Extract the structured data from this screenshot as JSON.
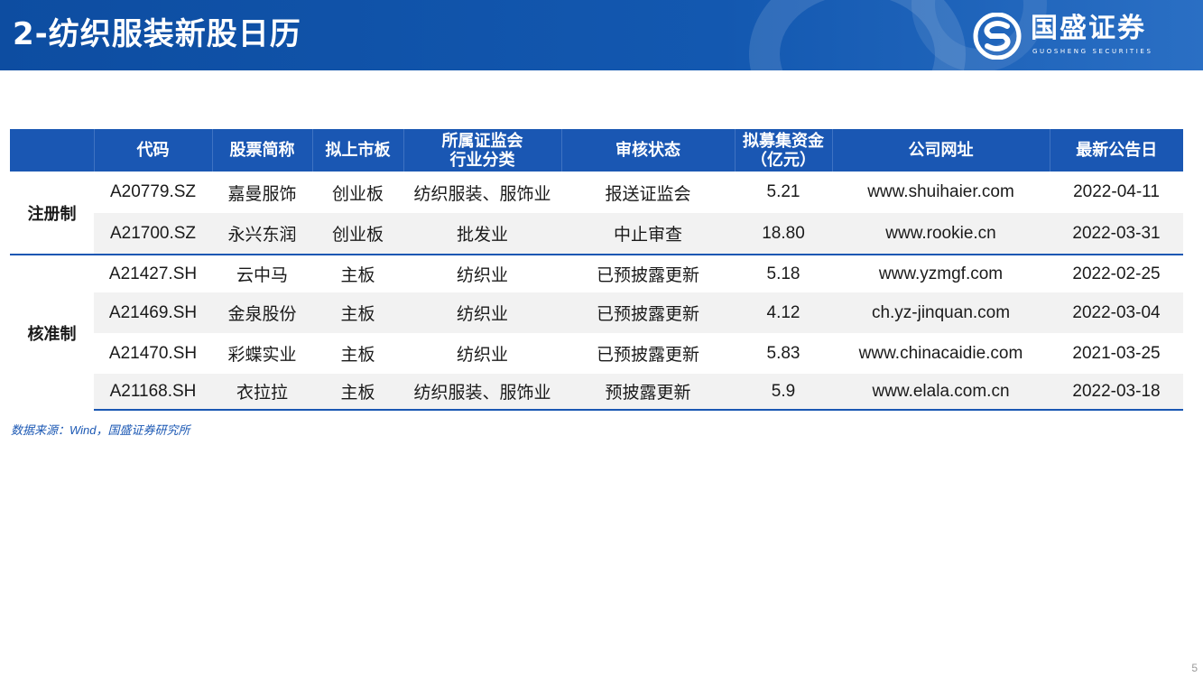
{
  "header": {
    "title": "2-纺织服装新股日历",
    "logo_name": "国盛证券",
    "logo_en": "GUOSHENG SECURITIES"
  },
  "table": {
    "columns": [
      "",
      "代码",
      "股票简称",
      "拟上市板",
      "所属证监会\n行业分类",
      "审核状态",
      "拟募集资金\n（亿元）",
      "公司网址",
      "最新公告日"
    ],
    "groups": [
      {
        "name": "注册制",
        "rows": [
          [
            "A20779.SZ",
            "嘉曼服饰",
            "创业板",
            "纺织服装、服饰业",
            "报送证监会",
            "5.21",
            "www.shuihaier.com",
            "2022-04-11"
          ],
          [
            "A21700.SZ",
            "永兴东润",
            "创业板",
            "批发业",
            "中止审查",
            "18.80",
            "www.rookie.cn",
            "2022-03-31"
          ]
        ]
      },
      {
        "name": "核准制",
        "rows": [
          [
            "A21427.SH",
            "云中马",
            "主板",
            "纺织业",
            "已预披露更新",
            "5.18",
            "www.yzmgf.com",
            "2022-02-25"
          ],
          [
            "A21469.SH",
            "金泉股份",
            "主板",
            "纺织业",
            "已预披露更新",
            "4.12",
            "ch.yz-jinquan.com",
            "2022-03-04"
          ],
          [
            "A21470.SH",
            "彩蝶实业",
            "主板",
            "纺织业",
            "已预披露更新",
            "5.83",
            "www.chinacaidie.com",
            "2021-03-25"
          ],
          [
            "A21168.SH",
            "衣拉拉",
            "主板",
            "纺织服装、服饰业",
            "预披露更新",
            "5.9",
            "www.elala.com.cn",
            "2022-03-18"
          ]
        ]
      }
    ]
  },
  "source": "数据来源：Wind，国盛证券研究所",
  "page_number": "5",
  "colors": {
    "brand_blue": "#1a57b3",
    "header_blue": "#0d4da1",
    "row_shade": "#f2f2f2"
  }
}
